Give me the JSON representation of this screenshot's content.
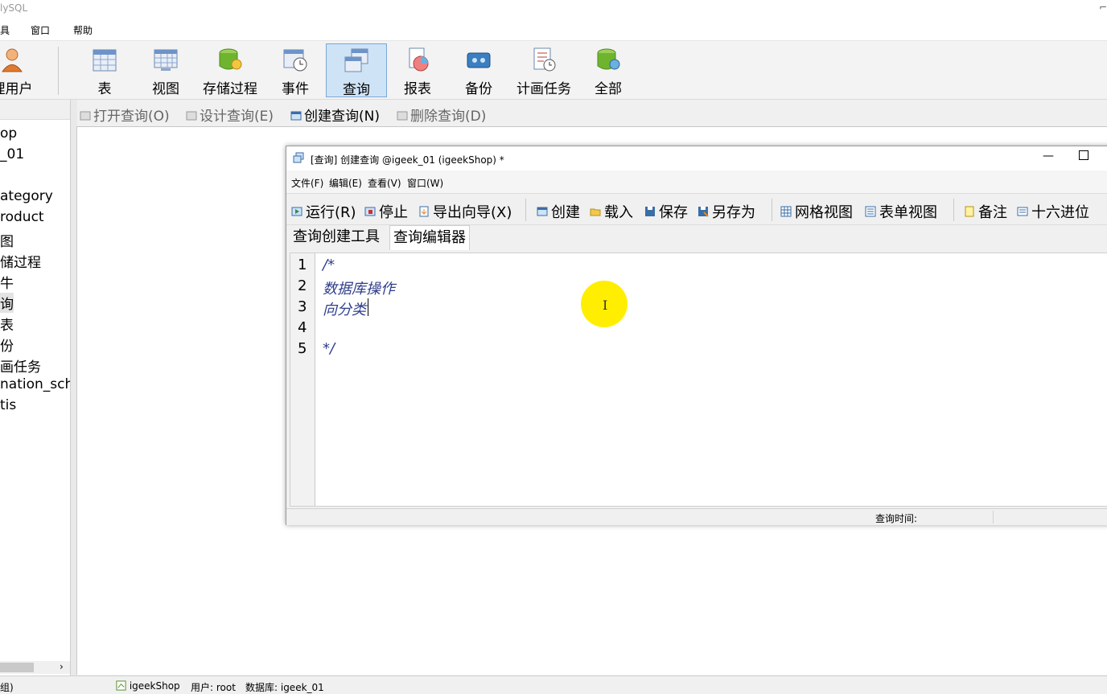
{
  "app": {
    "title": "lySQL",
    "max_glyph": "⌐"
  },
  "menu": {
    "items": [
      "具",
      "窗口",
      "帮助"
    ]
  },
  "toolbar": {
    "buttons": [
      {
        "label": "理用户",
        "icon": "user-icon"
      },
      {
        "label": "表",
        "icon": "table-icon"
      },
      {
        "label": "视图",
        "icon": "view-icon"
      },
      {
        "label": "存储过程",
        "icon": "procedure-icon"
      },
      {
        "label": "事件",
        "icon": "event-icon"
      },
      {
        "label": "查询",
        "icon": "query-icon",
        "active": true
      },
      {
        "label": "报表",
        "icon": "report-icon"
      },
      {
        "label": "备份",
        "icon": "backup-icon"
      },
      {
        "label": "计画任务",
        "icon": "schedule-icon"
      },
      {
        "label": "全部",
        "icon": "all-icon"
      }
    ]
  },
  "tree": {
    "items": [
      "op",
      "_01",
      "ategory",
      "roduct",
      "图",
      "储过程",
      "牛",
      "询",
      "表",
      "份",
      "画任务",
      "nation_sch",
      "tis"
    ]
  },
  "object_toolbar": {
    "open": "打开查询(O)",
    "design": "设计查询(E)",
    "create": "创建查询(N)",
    "delete": "删除查询(D)"
  },
  "query_window": {
    "title": "[查询] 创建查询 @igeek_01 (igeekShop) *",
    "min_glyph": "—",
    "menu": [
      "文件(F)",
      "编辑(E)",
      "查看(V)",
      "窗口(W)"
    ],
    "toolbar": {
      "run": "运行(R)",
      "stop": "停止",
      "export": "导出向导(X)",
      "create": "创建",
      "load": "载入",
      "save": "保存",
      "save_as": "另存为",
      "grid_view": "网格视图",
      "form_view": "表单视图",
      "notes": "备注",
      "hex": "十六进位"
    },
    "tabs": [
      "查询创建工具",
      "查询编辑器"
    ],
    "active_tab": "查询编辑器",
    "editor": {
      "line_numbers": [
        "1",
        "2",
        "3",
        "4",
        "5"
      ],
      "lines": [
        "/*",
        "数据库操作",
        "向分类",
        "",
        "*/"
      ]
    },
    "status": {
      "query_time": "查询时间:"
    }
  },
  "status_bar": {
    "left": "组)",
    "connection": "igeekShop",
    "user": "用户: root",
    "database": "数据库: igeek_01"
  },
  "colors": {
    "accent": "#cfe3f6",
    "code": "#2e3e8a",
    "cursor_highlight": "#ffee00"
  }
}
